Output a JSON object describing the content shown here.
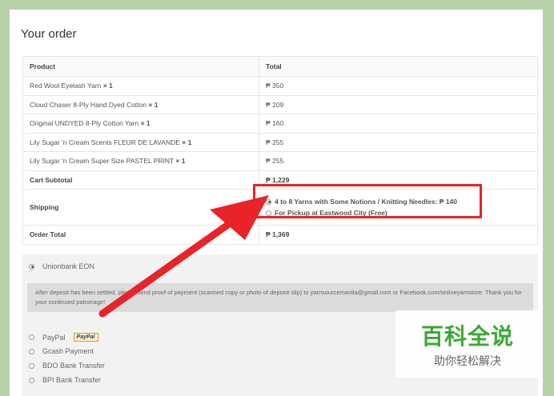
{
  "order": {
    "title": "Your order",
    "headers": {
      "product": "Product",
      "total": "Total"
    },
    "items": [
      {
        "name": "Red Wool Eyelash Yarn",
        "qty": "× 1",
        "total": "₱ 350"
      },
      {
        "name": "Cloud Chaser 8-Ply Hand Dyed Cotton",
        "qty": "× 1",
        "total": "₱ 209"
      },
      {
        "name": "Original UNDYED 8-Ply Cotton Yarn",
        "qty": "× 1",
        "total": "₱ 160"
      },
      {
        "name": "Lily Sugar 'n Cream Scents FLEUR DE LAVANDE",
        "qty": "× 1",
        "total": "₱ 255"
      },
      {
        "name": "Lily Sugar 'n Cream Super Size PASTEL PRINT",
        "qty": "× 1",
        "total": "₱ 255"
      }
    ],
    "cart_subtotal": {
      "label": "Cart Subtotal",
      "value": "₱ 1,229"
    },
    "shipping": {
      "label": "Shipping",
      "options": [
        {
          "label": "4 to 8 Yarns with Some Notions / Knitting Needles: ₱ 140",
          "selected": true
        },
        {
          "label": "For Pickup at Eastwood City (Free)",
          "selected": false
        }
      ]
    },
    "order_total": {
      "label": "Order Total",
      "value": "₱ 1,369"
    }
  },
  "payment": {
    "methods": [
      {
        "label": "Unionbank EON",
        "selected": true
      },
      {
        "label": "PayPal",
        "selected": false,
        "badge": "PayPal"
      },
      {
        "label": "Gcash Payment",
        "selected": false
      },
      {
        "label": "BDO Bank Transfer",
        "selected": false
      },
      {
        "label": "BPI Bank Transfer",
        "selected": false
      }
    ],
    "deposit_note": "After deposit has been settled, please send proof of payment (scanned copy or photo of deposit slip) to yarnsourcemanila@gmail.com or Facebook.com/onlineyarnstore. Thank you for your continued patronage!"
  },
  "watermark": {
    "main": "百科全说",
    "sub": "助你轻松解决"
  },
  "colors": {
    "background": "#b9d2a9",
    "highlight": "#e8232a",
    "watermark_green": "#3aa935"
  }
}
